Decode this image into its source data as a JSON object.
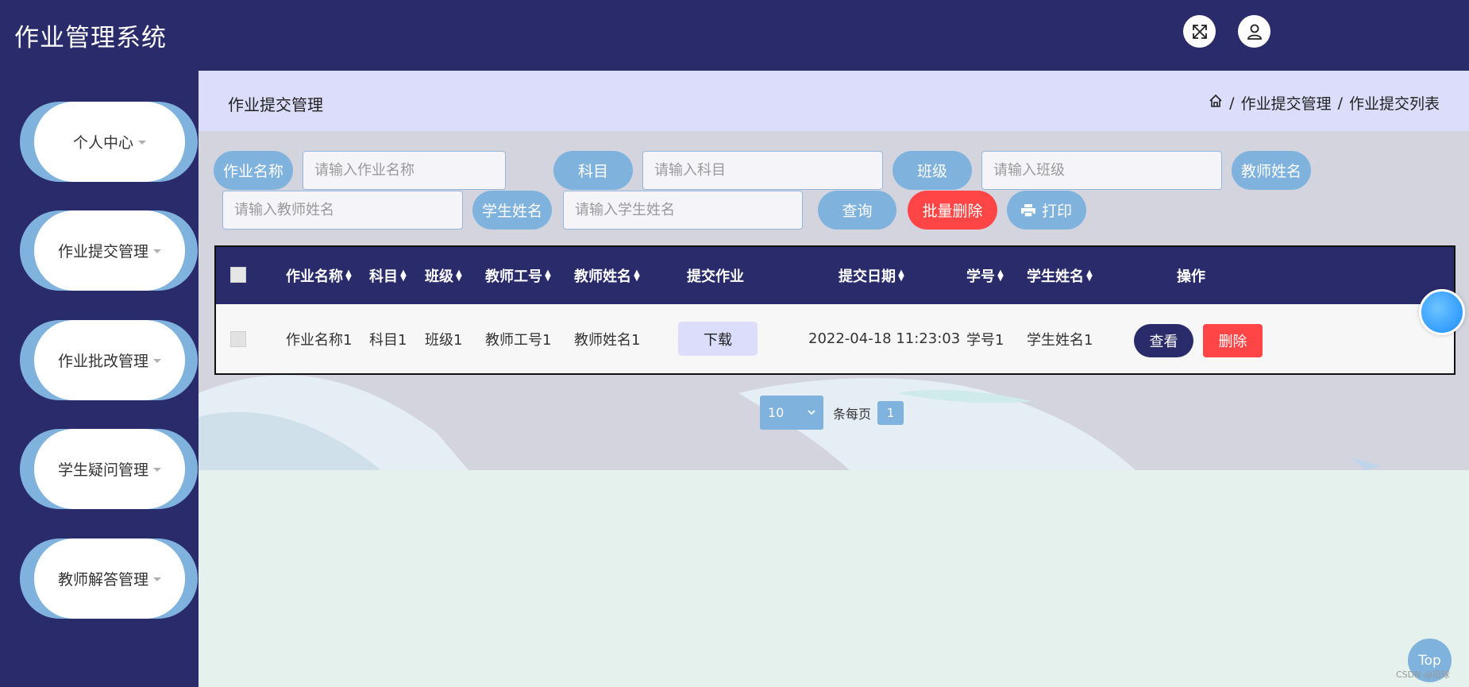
{
  "app": {
    "title": "作业管理系统"
  },
  "topbar": {
    "fullscreen_icon": "fullscreen-icon",
    "user_icon": "user-icon"
  },
  "sidebar": {
    "items": [
      {
        "label": "个人中心"
      },
      {
        "label": "作业提交管理"
      },
      {
        "label": "作业批改管理"
      },
      {
        "label": "学生疑问管理"
      },
      {
        "label": "教师解答管理"
      }
    ]
  },
  "page": {
    "title": "作业提交管理",
    "breadcrumb": {
      "home_icon": "home-icon",
      "separator": "/",
      "items": [
        "作业提交管理",
        "作业提交列表"
      ]
    }
  },
  "search": {
    "fields": [
      {
        "label": "作业名称",
        "placeholder": "请输入作业名称"
      },
      {
        "label": "科目",
        "placeholder": "请输入科目"
      },
      {
        "label": "班级",
        "placeholder": "请输入班级"
      },
      {
        "label": "教师姓名",
        "placeholder": "请输入教师姓名"
      },
      {
        "label": "学生姓名",
        "placeholder": "请输入学生姓名"
      }
    ],
    "query_label": "查询",
    "batch_delete_label": "批量删除",
    "print_label": "打印"
  },
  "table": {
    "headers": [
      "作业名称",
      "科目",
      "班级",
      "教师工号",
      "教师姓名",
      "提交作业",
      "提交日期",
      "学号",
      "学生姓名",
      "操作"
    ],
    "rows": [
      {
        "name": "作业名称1",
        "subject": "科目1",
        "class": "班级1",
        "teacher_id": "教师工号1",
        "teacher_name": "教师姓名1",
        "download_label": "下载",
        "date": "2022-04-18 11:23:03",
        "student_id": "学号1",
        "student_name": "学生姓名1",
        "view_label": "查看",
        "delete_label": "删除"
      }
    ]
  },
  "pagination": {
    "page_size": "10",
    "per_page_label": "条每页",
    "current_page": "1"
  },
  "floating": {
    "top_label": "Top"
  },
  "watermark": "CSDN @旧球",
  "colors": {
    "navy": "#2a2b6b",
    "accent_blue": "#7fb2dc",
    "danger": "#ff4545",
    "header_bg": "#dcdcfb"
  }
}
